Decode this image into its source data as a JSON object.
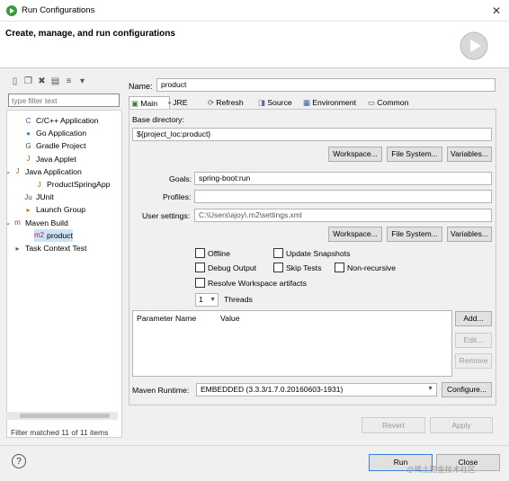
{
  "window": {
    "title": "Run Configurations",
    "close_glyph": "✕"
  },
  "header": {
    "title": "Create, manage, and run configurations"
  },
  "left": {
    "filter_placeholder": "type filter text",
    "status": "Filter matched 11 of 11 items",
    "tree": [
      {
        "label": "C/C++ Application",
        "icon": "C",
        "expand": ""
      },
      {
        "label": "Go Application",
        "icon": "●",
        "expand": ""
      },
      {
        "label": "Gradle Project",
        "icon": "G",
        "expand": ""
      },
      {
        "label": "Java Applet",
        "icon": "J",
        "expand": ""
      },
      {
        "label": "Java Application",
        "icon": "J",
        "expand": "⌄"
      },
      {
        "label": "ProductSpringApp",
        "icon": "J",
        "expand": ""
      },
      {
        "label": "JUnit",
        "icon": "Ju",
        "expand": ""
      },
      {
        "label": "Launch Group",
        "icon": "▸",
        "expand": ""
      },
      {
        "label": "Maven Build",
        "icon": "m",
        "expand": "⌄"
      },
      {
        "label": "product",
        "icon": "m2",
        "expand": ""
      },
      {
        "label": "Task Context Test",
        "icon": "▸",
        "expand": ""
      }
    ]
  },
  "form": {
    "name_label": "Name:",
    "name_value": "product",
    "tabs": [
      "Main",
      "JRE",
      "Refresh",
      "Source",
      "Environment",
      "Common"
    ],
    "base_dir_label": "Base directory:",
    "base_dir_value": "${project_loc:product}",
    "btn_workspace": "Workspace...",
    "btn_filesystem": "File System...",
    "btn_variables": "Variables...",
    "goals_label": "Goals:",
    "goals_value": "spring-boot:run",
    "profiles_label": "Profiles:",
    "profiles_value": "",
    "user_settings_label": "User settings:",
    "user_settings_value": "C:\\Users\\ajoy\\.m2\\settings.xml",
    "cb_offline": "Offline",
    "cb_update_snapshots": "Update Snapshots",
    "cb_debug_output": "Debug Output",
    "cb_skip_tests": "Skip Tests",
    "cb_non_recursive": "Non-recursive",
    "cb_resolve_workspace": "Resolve Workspace artifacts",
    "threads_value": "1",
    "threads_label": "Threads",
    "param_col_name": "Parameter Name",
    "param_col_value": "Value",
    "btn_add": "Add...",
    "btn_edit": "Edit...",
    "btn_remove": "Remove",
    "runtime_label": "Maven Runtime:",
    "runtime_value": "EMBEDDED (3.3.3/1.7.0.20160603-1931)",
    "btn_configure": "Configure...",
    "btn_revert": "Revert",
    "btn_apply": "Apply"
  },
  "footer": {
    "help": "?",
    "run": "Run",
    "close": "Close",
    "watermark": "@稀土掘金技术社区"
  }
}
